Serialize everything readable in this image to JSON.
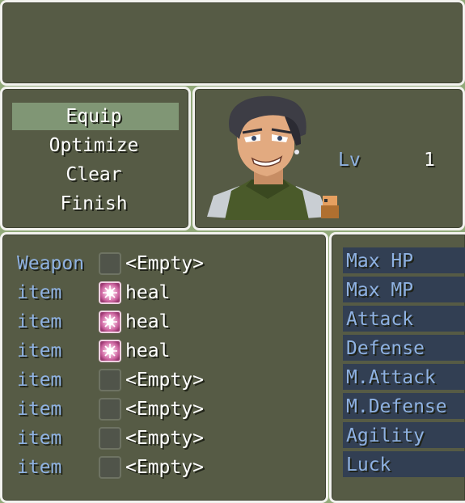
{
  "command_menu": {
    "items": [
      "Equip",
      "Optimize",
      "Clear",
      "Finish"
    ],
    "selected": "Equip"
  },
  "actor": {
    "level_label": "Lv",
    "level_value": "1"
  },
  "equipment_slots": [
    {
      "slot": "Weapon",
      "item": "<Empty>",
      "icon": "empty-slot-icon"
    },
    {
      "slot": "item",
      "item": "heal",
      "icon": "heal-icon"
    },
    {
      "slot": "item",
      "item": "heal",
      "icon": "heal-icon"
    },
    {
      "slot": "item",
      "item": "heal",
      "icon": "heal-icon"
    },
    {
      "slot": "item",
      "item": "<Empty>",
      "icon": "empty-slot-icon"
    },
    {
      "slot": "item",
      "item": "<Empty>",
      "icon": "empty-slot-icon"
    },
    {
      "slot": "item",
      "item": "<Empty>",
      "icon": "empty-slot-icon"
    },
    {
      "slot": "item",
      "item": "<Empty>",
      "icon": "empty-slot-icon"
    }
  ],
  "stats": [
    "Max HP",
    "Max MP",
    "Attack",
    "Defense",
    "M.Attack",
    "M.Defense",
    "Agility",
    "Luck"
  ],
  "colors": {
    "window_bg": "#565b45",
    "window_border": "#f2f2ee",
    "system_blue": "#8fb2e2",
    "selection": "#8faa85",
    "stat_bg": "#323f53"
  }
}
